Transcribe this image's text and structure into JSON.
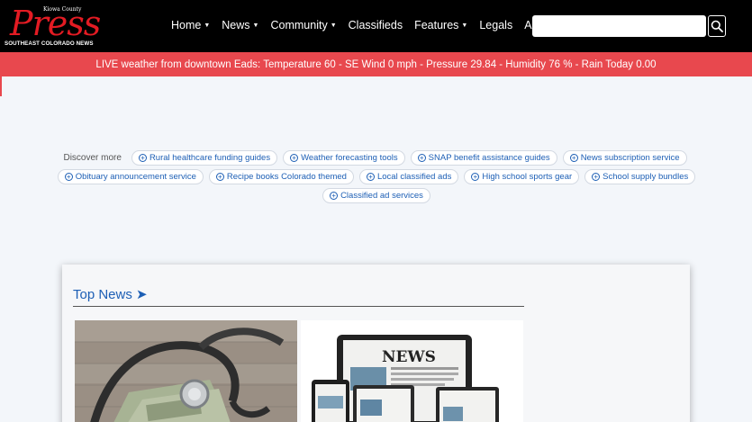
{
  "header": {
    "logo": {
      "top_line": "Kiowa County",
      "name": "Press",
      "tagline": "SOUTHEAST COLORADO NEWS"
    },
    "nav": [
      {
        "label": "Home",
        "dropdown": true
      },
      {
        "label": "News",
        "dropdown": true
      },
      {
        "label": "Community",
        "dropdown": true
      },
      {
        "label": "Classifieds",
        "dropdown": false
      },
      {
        "label": "Features",
        "dropdown": true
      },
      {
        "label": "Legals",
        "dropdown": false
      },
      {
        "label": "About",
        "dropdown": false
      }
    ],
    "search": {
      "value": "",
      "placeholder": "",
      "icon": "search-icon"
    }
  },
  "weather_bar": {
    "text": "LIVE weather from downtown Eads: Temperature 60 - SE Wind 0 mph - Pressure 29.84 - Humidity 76 % - Rain Today 0.00"
  },
  "discover": {
    "label": "Discover more",
    "chips": [
      "Rural healthcare funding guides",
      "Weather forecasting tools",
      "SNAP benefit assistance guides",
      "News subscription service",
      "Obituary announcement service",
      "Recipe books Colorado themed",
      "Local classified ads",
      "High school sports gear",
      "School supply bundles",
      "Classified ad services"
    ]
  },
  "top_news": {
    "title": "Top News ➤",
    "images": [
      {
        "icon": "stethoscope-money-image"
      },
      {
        "icon": "news-devices-image",
        "screen_text": "NEWS"
      }
    ]
  },
  "colors": {
    "header_bg": "#000000",
    "logo_red": "#e31b23",
    "weather_bg": "#e8484e",
    "link_blue": "#1d5fb5",
    "page_bg": "#f3f6fa"
  }
}
